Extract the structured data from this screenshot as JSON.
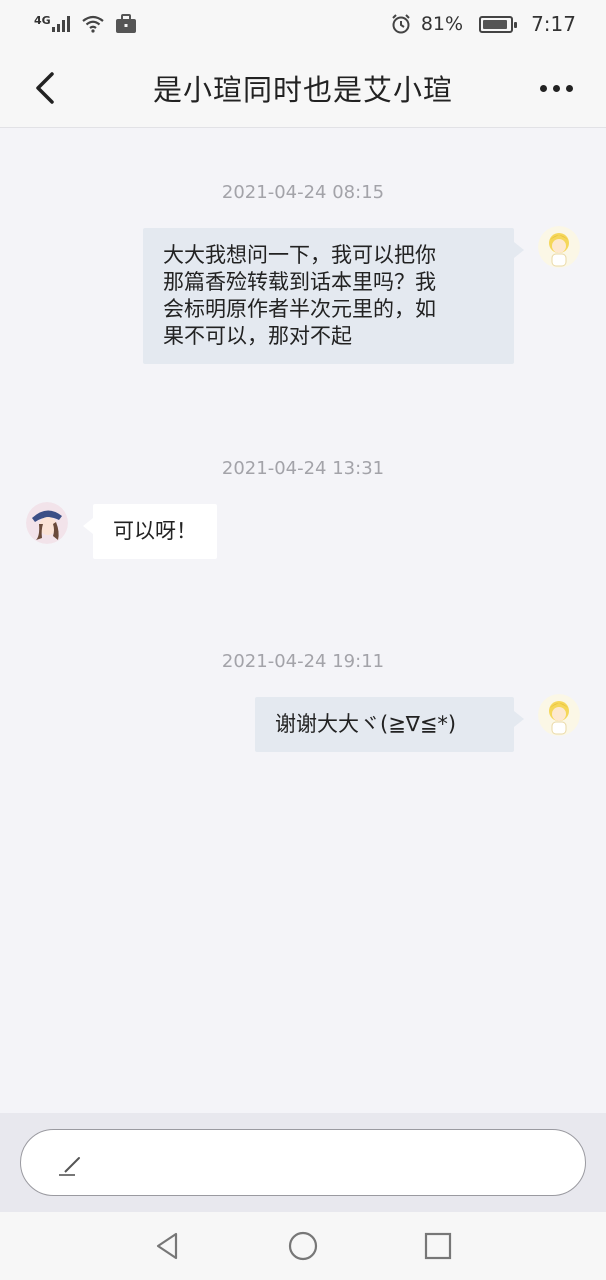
{
  "status_bar": {
    "network": "4G",
    "battery_percent": "81%",
    "battery_level": 0.81,
    "time": "7:17"
  },
  "header": {
    "title": "是小瑄同时也是艾小瑄",
    "back_icon": "chevron-left-icon",
    "more_icon": "more-dots-icon"
  },
  "messages": [
    {
      "timestamp": "2021-04-24 08:15",
      "direction": "out",
      "lines": [
        "大大我想问一下，我可以把你",
        "那篇香殓转载到话本里吗？我",
        "会标明原作者半次元里的，如",
        "果不可以，那对不起"
      ]
    },
    {
      "timestamp": "2021-04-24 13:31",
      "direction": "in",
      "text": "可以呀！"
    },
    {
      "timestamp": "2021-04-24 19:11",
      "direction": "out",
      "text": "谢谢大大ヾ(≧∇≦*)"
    }
  ],
  "input": {
    "icon": "pen-icon"
  },
  "nav_bar": {
    "back": "triangle-back-icon",
    "home": "circle-home-icon",
    "recents": "square-recents-icon"
  },
  "colors": {
    "background": "#f4f4f8",
    "outgoing_bubble": "#e4e9f0",
    "incoming_bubble": "#ffffff",
    "timestamp": "#a3a3a9"
  }
}
